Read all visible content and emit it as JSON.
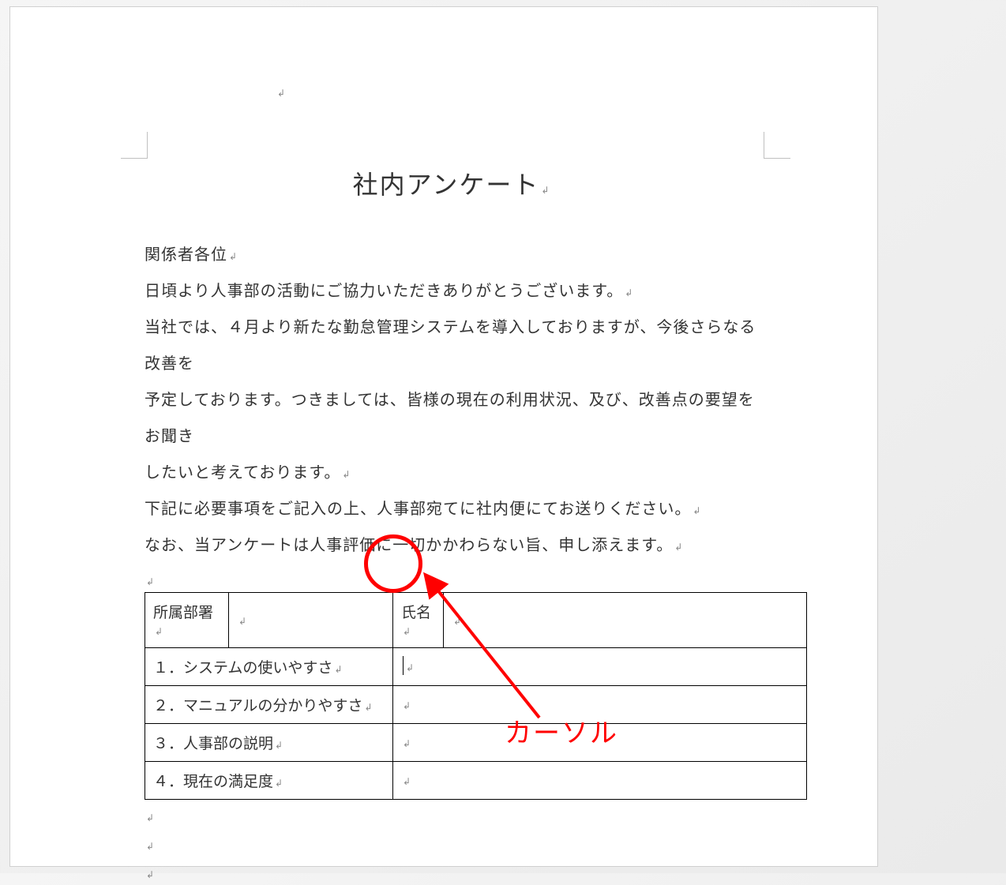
{
  "title": "社内アンケート",
  "body": {
    "greeting": "関係者各位",
    "line1": "日頃より人事部の活動にご協力いただきありがとうございます。",
    "p2a": "当社では、４月より新たな勤怠管理システムを導入しておりますが、今後さらなる改善を",
    "p2b": "予定しております。つきましては、皆様の現在の利用状況、及び、改善点の要望をお聞き",
    "p2c": "したいと考えております。",
    "line3": "下記に必要事項をご記入の上、人事部宛てに社内便にてお送りください。",
    "line4": "なお、当アンケートは人事評価に一切かかわらない旨、申し添えます。"
  },
  "table": {
    "dept_label": "所属部署",
    "dept_value": "",
    "name_label": "氏名",
    "name_value": "",
    "rows": [
      {
        "q": "１．システムの使いやすさ",
        "a": ""
      },
      {
        "q": "２．マニュアルの分かりやすさ",
        "a": ""
      },
      {
        "q": "３．人事部の説明",
        "a": ""
      },
      {
        "q": "４．現在の満足度",
        "a": ""
      }
    ]
  },
  "annotation": {
    "cursor_label": "カーソル"
  },
  "pmark": "↲"
}
